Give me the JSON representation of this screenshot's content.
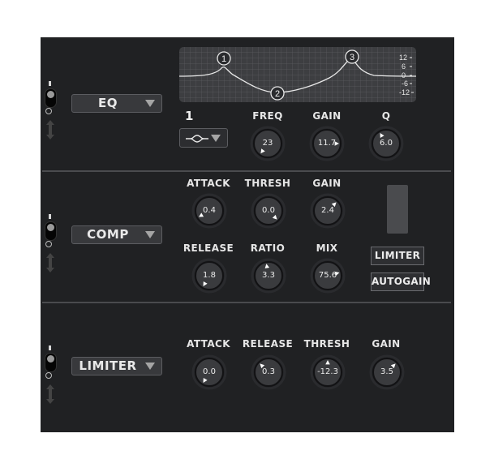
{
  "eq": {
    "selector_label": "EQ",
    "band_number": "1",
    "graph": {
      "db_scale": [
        "12",
        "6",
        "0",
        "-6",
        "-12"
      ],
      "nodes": [
        {
          "label": "1"
        },
        {
          "label": "2"
        },
        {
          "label": "3"
        }
      ]
    },
    "filter_type_icon": "bell-filter-icon",
    "knobs": [
      {
        "label": "FREQ",
        "value": "23"
      },
      {
        "label": "GAIN",
        "value": "11.7"
      },
      {
        "label": "Q",
        "value": "6.0"
      }
    ]
  },
  "comp": {
    "selector_label": "COMP",
    "knobs_top": [
      {
        "label": "ATTACK",
        "value": "0.4"
      },
      {
        "label": "THRESH",
        "value": "0.0"
      },
      {
        "label": "GAIN",
        "value": "2.4"
      }
    ],
    "knobs_bottom": [
      {
        "label": "RELEASE",
        "value": "1.8"
      },
      {
        "label": "RATIO",
        "value": "3.3"
      },
      {
        "label": "MIX",
        "value": "75.6"
      }
    ],
    "buttons": {
      "limiter": "LIMITER",
      "autogain": "AUTOGAIN"
    }
  },
  "limiter": {
    "selector_label": "LIMITER",
    "knobs": [
      {
        "label": "ATTACK",
        "value": "0.0"
      },
      {
        "label": "RELEASE",
        "value": "0.3"
      },
      {
        "label": "THRESH",
        "value": "-12.3"
      },
      {
        "label": "GAIN",
        "value": "3.5"
      }
    ]
  },
  "colors": {
    "panel": "#202123",
    "knob_body": "#3a3b3e",
    "knob_indicator": "#ffffff",
    "text": "#e6e6e6"
  }
}
